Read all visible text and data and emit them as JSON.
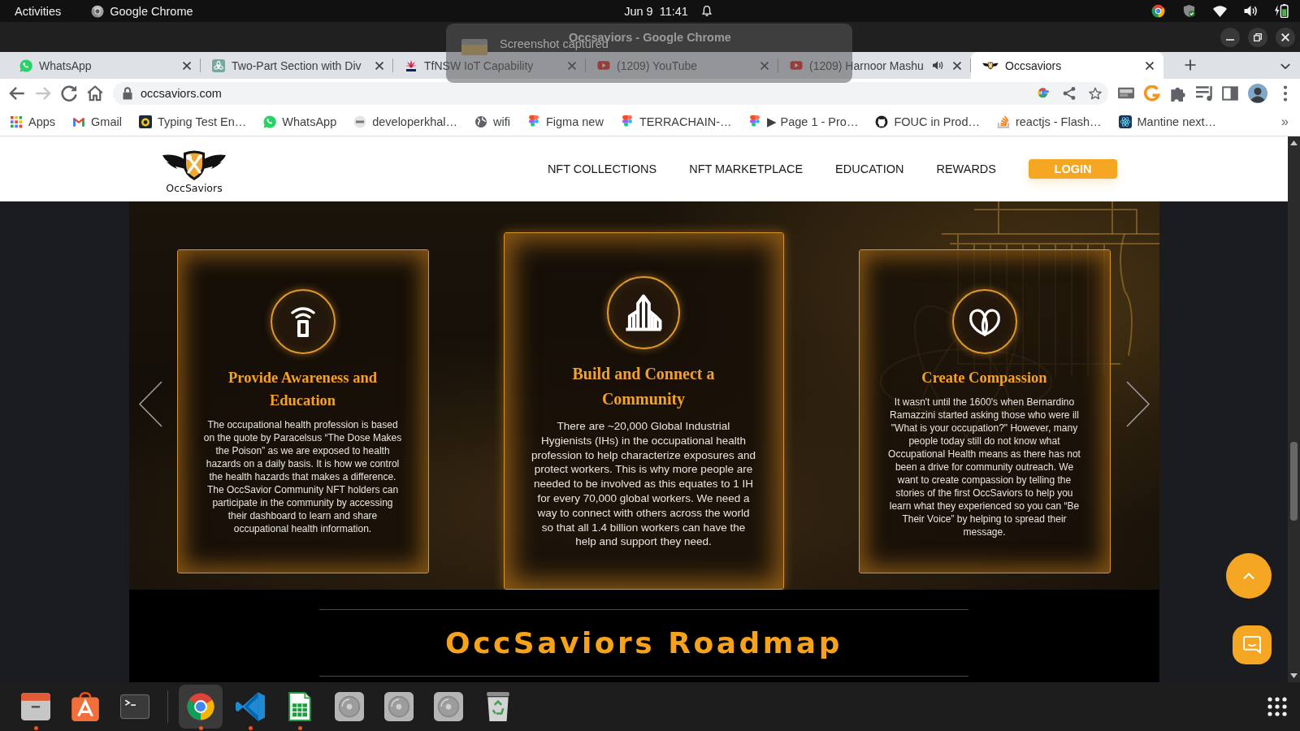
{
  "top_bar": {
    "activities": "Activities",
    "app_name": "Google Chrome",
    "clock": "Jun 9  11:41"
  },
  "notification": {
    "title": "Screenshot captured"
  },
  "window": {
    "title": "Occsaviors - Google Chrome"
  },
  "tabs": [
    {
      "title": "WhatsApp",
      "selected": false,
      "audio": false
    },
    {
      "title": "Two-Part Section with Div",
      "selected": false,
      "audio": false
    },
    {
      "title": "TfNSW IoT Capability",
      "selected": false,
      "audio": false
    },
    {
      "title": "(1209) YouTube",
      "selected": false,
      "audio": false
    },
    {
      "title": "(1209) Harnoor Mashu",
      "selected": false,
      "audio": true
    },
    {
      "title": "Occsaviors",
      "selected": true,
      "audio": false
    }
  ],
  "toolbar": {
    "nav_buttons": [
      {
        "disabled": false
      },
      {
        "disabled": true
      },
      {
        "disabled": false
      },
      {
        "disabled": false
      }
    ],
    "url": "occsaviors.com"
  },
  "bookmarks": {
    "items": [
      "Apps",
      "Gmail",
      "Typing Test En…",
      "WhatsApp",
      "developerkhal…",
      "wifi",
      "Figma new",
      "TERRACHAIN-…",
      "▶ Page 1 - Pro…",
      "FOUC in Prod…",
      "reactjs - Flash…",
      "Mantine next…"
    ],
    "overflow": "»"
  },
  "site": {
    "logo_text": "OccSaviors",
    "nav": [
      "NFT COLLECTIONS",
      "NFT MARKETPLACE",
      "EDUCATION",
      "REWARDS"
    ],
    "login": "LOGIN"
  },
  "features": [
    {
      "title": "Provide Awareness and Education",
      "body": "The occupational health profession is based on the quote by Paracelsus “The Dose Makes the Poison” as we are exposed to health hazards on a daily basis. It is how we control the health hazards that makes a difference. The OccSavior Community NFT holders can participate in the community by accessing their dashboard to learn and share occupational health information.",
      "selected": false
    },
    {
      "title": "Build and Connect a Community",
      "body": "There are ~20,000 Global Industrial Hygienists (IHs) in the occupational health profession to help characterize exposures and protect workers. This is why more people are needed to be involved as this equates to 1 IH for every 70,000 global workers. We need a way to connect with others across the world so that all 1.4 billion workers can have the help and support they need.",
      "selected": true
    },
    {
      "title": "Create Compassion",
      "body": "It wasn't until the 1600's when Bernardino Ramazzini started asking those who were ill \"What is your occupation?\" However, many people today still do not know what Occupational Health means as there has not been a drive for community outreach. We want to create compassion by telling the stories of the first OccSaviors to help you learn what they experienced so you can “Be Their Voice” by helping to spread their message.",
      "selected": false
    }
  ],
  "roadmap": {
    "title": "OccSaviors Roadmap"
  },
  "dock": [
    {
      "running": true,
      "selected": false
    },
    {
      "running": false,
      "selected": false
    },
    {
      "running": false,
      "selected": false
    },
    {
      "running": true,
      "selected": true
    },
    {
      "running": true,
      "selected": false
    },
    {
      "running": true,
      "selected": false
    },
    {
      "running": false,
      "selected": false
    },
    {
      "running": false,
      "selected": false
    },
    {
      "running": false,
      "selected": false
    },
    {
      "running": false,
      "selected": false
    }
  ]
}
